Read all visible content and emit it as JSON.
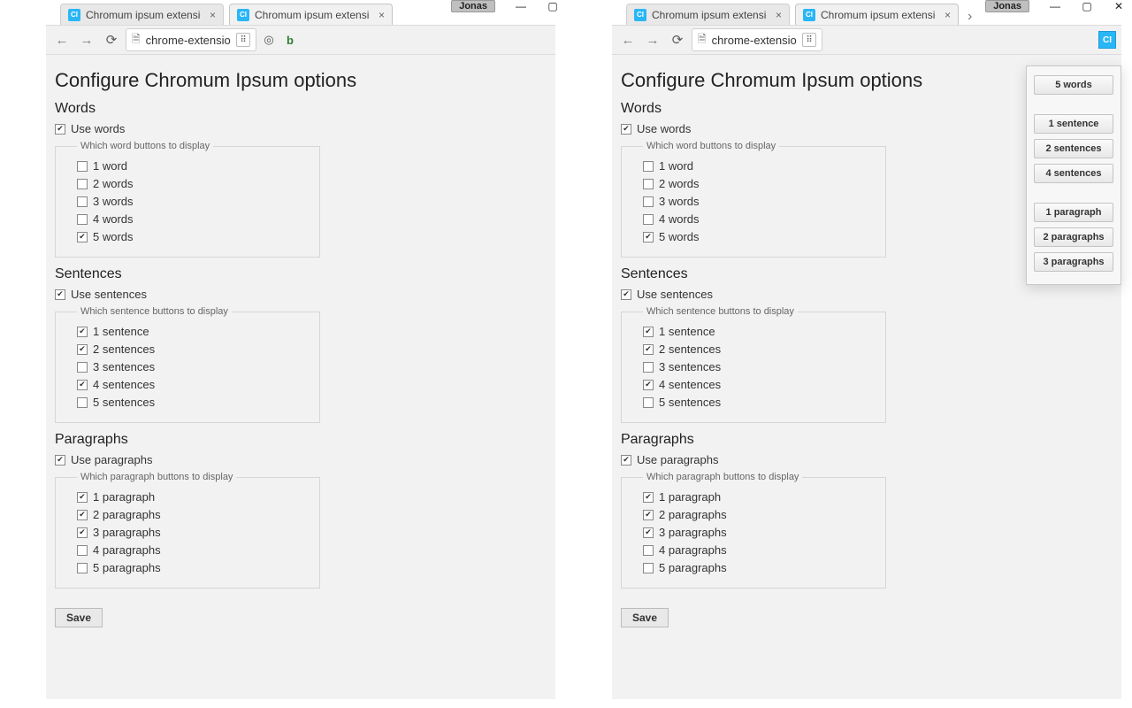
{
  "os": {
    "user": "Jonas"
  },
  "left": {
    "tabs": [
      {
        "fav": "CI",
        "label": "Chromum ipsum extensio"
      },
      {
        "fav": "CI",
        "label": "Chromum ipsum extensio"
      }
    ],
    "active_tab_index": 1,
    "omnibox": {
      "text": "chrome-extensio"
    },
    "toolbar_ext": [
      {
        "name": "options-icon"
      },
      {
        "name": "bold-icon",
        "glyph": "b"
      }
    ],
    "page": {
      "title": "Configure Chromum Ipsum options",
      "sections": {
        "words": {
          "heading": "Words",
          "use_label": "Use words",
          "use_checked": true,
          "legend": "Which word buttons to display",
          "options": [
            {
              "label": "1 word",
              "checked": false
            },
            {
              "label": "2 words",
              "checked": false
            },
            {
              "label": "3 words",
              "checked": false
            },
            {
              "label": "4 words",
              "checked": false
            },
            {
              "label": "5 words",
              "checked": true
            }
          ]
        },
        "sentences": {
          "heading": "Sentences",
          "use_label": "Use sentences",
          "use_checked": true,
          "legend": "Which sentence buttons to display",
          "options": [
            {
              "label": "1 sentence",
              "checked": true
            },
            {
              "label": "2 sentences",
              "checked": true
            },
            {
              "label": "3 sentences",
              "checked": false
            },
            {
              "label": "4 sentences",
              "checked": true
            },
            {
              "label": "5 sentences",
              "checked": false
            }
          ]
        },
        "paragraphs": {
          "heading": "Paragraphs",
          "use_label": "Use paragraphs",
          "use_checked": true,
          "legend": "Which paragraph buttons to display",
          "options": [
            {
              "label": "1 paragraph",
              "checked": true
            },
            {
              "label": "2 paragraphs",
              "checked": true
            },
            {
              "label": "3 paragraphs",
              "checked": true
            },
            {
              "label": "4 paragraphs",
              "checked": false
            },
            {
              "label": "5 paragraphs",
              "checked": false
            }
          ]
        }
      },
      "save_label": "Save"
    }
  },
  "right": {
    "tabs": [
      {
        "fav": "CI",
        "label": "Chromum ipsum extensio"
      },
      {
        "fav": "CI",
        "label": "Chromum ipsum extensio"
      }
    ],
    "active_tab_index": 1,
    "omnibox": {
      "text": "chrome-extensio"
    },
    "ci_icon_label": "CI",
    "popup": {
      "groups": [
        [
          "5 words"
        ],
        [
          "1 sentence",
          "2 sentences",
          "4 sentences"
        ],
        [
          "1 paragraph",
          "2 paragraphs",
          "3 paragraphs"
        ]
      ]
    },
    "page": {
      "title": "Configure Chromum Ipsum options",
      "sections": {
        "words": {
          "heading": "Words",
          "use_label": "Use words",
          "use_checked": true,
          "legend": "Which word buttons to display",
          "options": [
            {
              "label": "1 word",
              "checked": false
            },
            {
              "label": "2 words",
              "checked": false
            },
            {
              "label": "3 words",
              "checked": false
            },
            {
              "label": "4 words",
              "checked": false
            },
            {
              "label": "5 words",
              "checked": true
            }
          ]
        },
        "sentences": {
          "heading": "Sentences",
          "use_label": "Use sentences",
          "use_checked": true,
          "legend": "Which sentence buttons to display",
          "options": [
            {
              "label": "1 sentence",
              "checked": true
            },
            {
              "label": "2 sentences",
              "checked": true
            },
            {
              "label": "3 sentences",
              "checked": false
            },
            {
              "label": "4 sentences",
              "checked": true
            },
            {
              "label": "5 sentences",
              "checked": false
            }
          ]
        },
        "paragraphs": {
          "heading": "Paragraphs",
          "use_label": "Use paragraphs",
          "use_checked": true,
          "legend": "Which paragraph buttons to display",
          "options": [
            {
              "label": "1 paragraph",
              "checked": true
            },
            {
              "label": "2 paragraphs",
              "checked": true
            },
            {
              "label": "3 paragraphs",
              "checked": true
            },
            {
              "label": "4 paragraphs",
              "checked": false
            },
            {
              "label": "5 paragraphs",
              "checked": false
            }
          ]
        }
      },
      "save_label": "Save"
    }
  }
}
